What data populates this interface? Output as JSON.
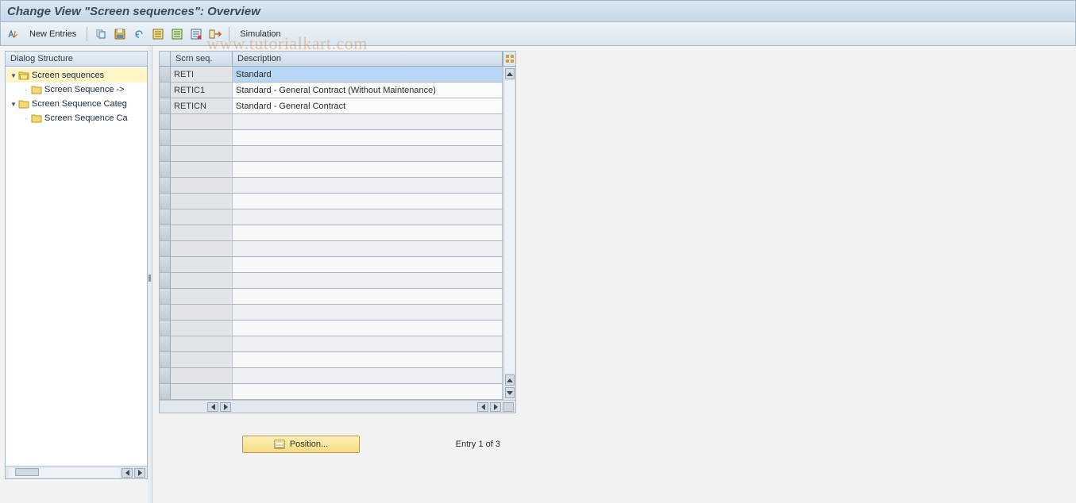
{
  "title": "Change View \"Screen sequences\": Overview",
  "toolbar": {
    "new_entries": "New Entries",
    "simulation": "Simulation",
    "icons": {
      "toggle": "toggle-mode-icon",
      "copy": "copy-icon",
      "save": "save-icon",
      "undo": "undo-icon",
      "select_all": "select-all-icon",
      "deselect_all": "deselect-all-icon",
      "delete": "delete-icon",
      "refresh": "refresh-icon",
      "exit": "exit-icon"
    }
  },
  "tree": {
    "header": "Dialog Structure",
    "nodes": [
      {
        "label": "Screen sequences",
        "level": 0,
        "expanded": true,
        "selected": true,
        "open": true
      },
      {
        "label": "Screen Sequence ->",
        "level": 1,
        "expanded": false,
        "selected": false,
        "open": false,
        "leaf": true
      },
      {
        "label": "Screen Sequence Categ",
        "level": 0,
        "expanded": true,
        "selected": false,
        "open": false
      },
      {
        "label": "Screen Sequence Ca",
        "level": 1,
        "expanded": false,
        "selected": false,
        "open": false,
        "leaf": true
      }
    ]
  },
  "grid": {
    "columns": {
      "c1": "Scrn seq.",
      "c2": "Description"
    },
    "rows": [
      {
        "seq": "RETI",
        "desc": "Standard",
        "desc_selected": true
      },
      {
        "seq": "RETIC1",
        "desc": "Standard - General Contract (Without Maintenance)"
      },
      {
        "seq": "RETICN",
        "desc": "Standard - General Contract"
      }
    ],
    "empty_rows": 18
  },
  "footer": {
    "position_button": "Position...",
    "entry_text": "Entry 1 of 3"
  },
  "watermark": "www.tutorialkart.com"
}
